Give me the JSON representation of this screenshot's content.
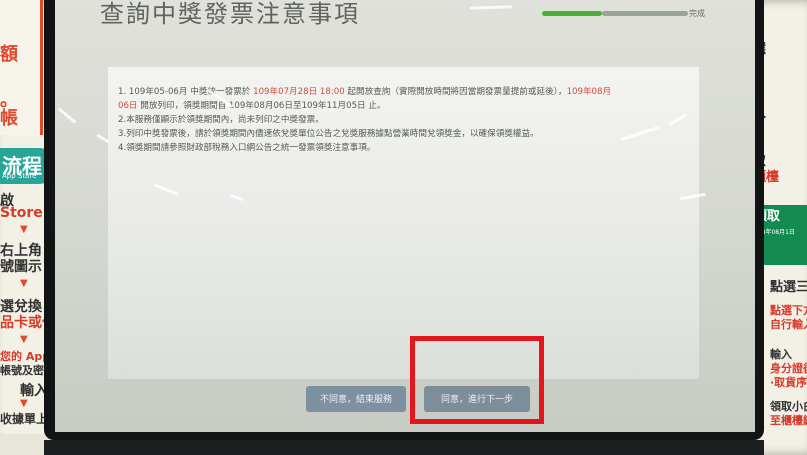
{
  "screen": {
    "title": "查詢中獎發票注意事項",
    "progress_label": "完成",
    "progress_value": 0.42
  },
  "notice": {
    "item1_a": "1. 109年05-06月 中獎統一發票於 ",
    "item1_date": "109年07月28日 18:00",
    "item1_b": " 起開放查詢（實際開放時間將因當期發票量提前或延後），",
    "item1_red2": "109年08月",
    "item1_red3": "06日",
    "item1_c": " 開放列印，領獎期間自 109年08月06日至109年11月05日 止。",
    "item2": "2.本服務僅顯示於領獎期間內，尚未列印之中獎發票。",
    "item3": "3.列印中獎發票後，請於領獎期間內儘速依兌獎單位公告之兌獎服務據點營業時間兌領獎金，以確保領獎權益。",
    "item4": "4.領獎期間請參照財政部稅務入口網公告之統一發票領獎注意事項。"
  },
  "buttons": {
    "disagree": "不同意，結束服務",
    "agree": "同意，進行下一步"
  },
  "poster_left": {
    "top_chars": [
      "額",
      "。",
      "帳"
    ],
    "flow_title": "流程",
    "flow_sub": "App Store",
    "step1": "啟",
    "step2": "Store",
    "step3": "右上角",
    "step4": "號圖示",
    "step5": "選兌換",
    "step6": "品卡或代碼",
    "step7": "您的 Apple ID",
    "step8": "帳號及密碼",
    "step9": "輸入",
    "step10": "收據單上的密碼"
  },
  "poster_right": {
    "items": [
      "點選",
      "插",
      "輸入",
      "確",
      "領取",
      "至櫃檯"
    ],
    "badge_title": "領取",
    "badge_sub": "108年08月1日",
    "items2": [
      "點選三",
      "點選下方",
      "自行輸入序號",
      "輸入",
      "身分證後四碼",
      "·取貨序號",
      "領取小白單",
      "至櫃檯繳款開票"
    ]
  }
}
